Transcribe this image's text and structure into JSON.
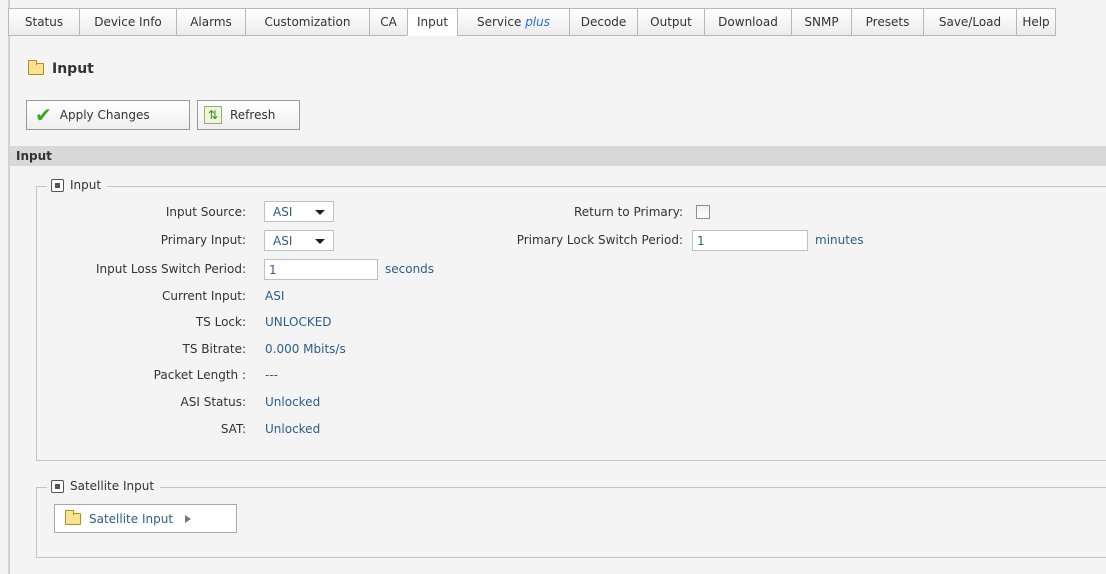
{
  "tabs": [
    {
      "label": "Status"
    },
    {
      "label": "Device Info"
    },
    {
      "label": "Alarms"
    },
    {
      "label": "Customization"
    },
    {
      "label": "CA"
    },
    {
      "label": "Input",
      "active": true
    },
    {
      "label": "Service",
      "suffix": "plus"
    },
    {
      "label": "Decode"
    },
    {
      "label": "Output"
    },
    {
      "label": "Download"
    },
    {
      "label": "SNMP"
    },
    {
      "label": "Presets"
    },
    {
      "label": "Save/Load"
    },
    {
      "label": "Help"
    }
  ],
  "page": {
    "title": "Input",
    "title_icon": "folder-icon"
  },
  "toolbar": {
    "apply_label": "Apply Changes",
    "apply_icon": "checkmark-icon",
    "refresh_label": "Refresh",
    "refresh_icon": "refresh-icon"
  },
  "section": {
    "title": "Input"
  },
  "input_group": {
    "legend": "Input",
    "fields": {
      "input_source": {
        "label": "Input Source:",
        "value": "ASI"
      },
      "primary_input": {
        "label": "Primary Input:",
        "value": "ASI"
      },
      "loss_switch": {
        "label": "Input Loss Switch Period:",
        "value": "1",
        "unit": "seconds"
      },
      "current_input": {
        "label": "Current Input:",
        "value": "ASI"
      },
      "ts_lock": {
        "label": "TS Lock:",
        "value": "UNLOCKED"
      },
      "ts_bitrate": {
        "label": "TS Bitrate:",
        "value": "0.000 Mbits/s"
      },
      "packet_length": {
        "label": "Packet Length :",
        "value": "---"
      },
      "asi_status": {
        "label": "ASI Status:",
        "value": "Unlocked"
      },
      "sat": {
        "label": "SAT:",
        "value": "Unlocked"
      },
      "return_to_primary": {
        "label": "Return to Primary:",
        "checked": false
      },
      "primary_lock_switch": {
        "label": "Primary Lock Switch Period:",
        "value": "1",
        "unit": "minutes"
      }
    }
  },
  "satellite_group": {
    "legend": "Satellite Input",
    "button_label": "Satellite Input"
  },
  "colors": {
    "value_text": "#2e5c8a",
    "section_header_bg": "#d8d8d8",
    "page_bg": "#f4f4f4",
    "check_green": "#3aa81c"
  }
}
